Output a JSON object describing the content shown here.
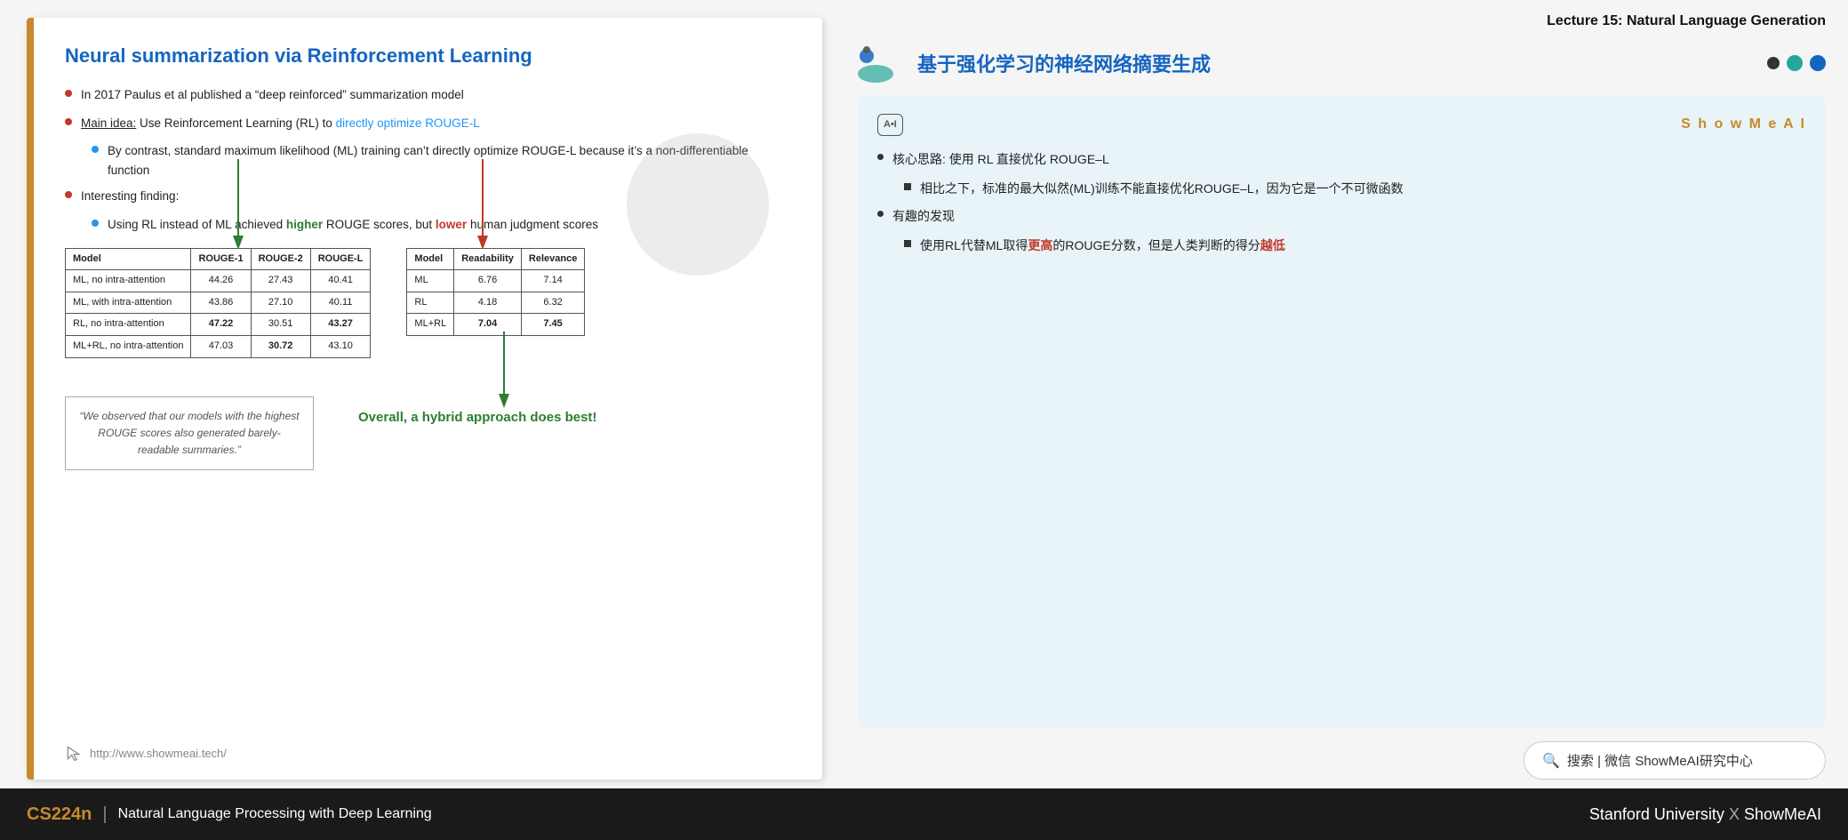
{
  "header": {
    "lecture_title": "Lecture 15: Natural Language Generation"
  },
  "slide": {
    "title": "Neural summarization via Reinforcement Learning",
    "bullets": [
      {
        "id": 1,
        "text_parts": [
          {
            "text": "In 2017 Paulus et al published a “deep reinforced” summarization model",
            "style": "normal"
          }
        ]
      },
      {
        "id": 2,
        "text_parts": [
          {
            "text": "Main idea:",
            "style": "underline"
          },
          {
            "text": " Use Reinforcement Learning (RL) to ",
            "style": "normal"
          },
          {
            "text": "directly optimize ROUGE-L",
            "style": "blue"
          }
        ],
        "subbullets": [
          {
            "text_parts": [
              {
                "text": "By contrast, standard maximum likelihood (ML) training can’t directly optimize ROUGE-L because it’s a non-differentiable function",
                "style": "normal"
              }
            ]
          }
        ]
      },
      {
        "id": 3,
        "text_parts": [
          {
            "text": "Interesting finding:",
            "style": "normal"
          }
        ],
        "subbullets": [
          {
            "text_parts": [
              {
                "text": "Using RL instead of ML achieved ",
                "style": "normal"
              },
              {
                "text": "higher",
                "style": "green"
              },
              {
                "text": " ROUGE scores, but ",
                "style": "normal"
              },
              {
                "text": "lower",
                "style": "red"
              },
              {
                "text": " human judgment scores",
                "style": "normal"
              }
            ]
          }
        ]
      }
    ],
    "table1": {
      "headers": [
        "Model",
        "ROUGE-1",
        "ROUGE-2",
        "ROUGE-L"
      ],
      "rows": [
        [
          "ML, no intra-attention",
          "44.26",
          "27.43",
          "40.41"
        ],
        [
          "ML, with intra-attention",
          "43.86",
          "27.10",
          "40.11"
        ],
        [
          "RL, no intra-attention",
          "47.22",
          "30.51",
          "43.27"
        ],
        [
          "ML+RL, no intra-attention",
          "47.03",
          "30.72",
          "43.10"
        ]
      ],
      "bold_rows": [
        2,
        3
      ],
      "bold_cells": {
        "2": [
          1,
          3
        ],
        "3": [
          2
        ]
      }
    },
    "table2": {
      "headers": [
        "Model",
        "Readability",
        "Relevance"
      ],
      "rows": [
        [
          "ML",
          "6.76",
          "7.14"
        ],
        [
          "RL",
          "4.18",
          "6.32"
        ],
        [
          "ML+RL",
          "7.04",
          "7.45"
        ]
      ],
      "bold_rows": [
        2
      ],
      "bold_cells": {
        "2": [
          1,
          2
        ]
      }
    },
    "quote": "“We observed that our models with the highest ROUGE scores also generated barely-readable summaries.”",
    "overall_text": "Overall, a hybrid approach does best!",
    "footer_url": "http://www.showmeai.tech/"
  },
  "right_panel": {
    "chinese_title": "基于强化学习的神经网络摘要生成",
    "showmeai_brand": "S h o w M e A I",
    "ai_badge": "A•I",
    "content": [
      {
        "type": "main",
        "text": "核心思路: 使用 RL 直接优化 ROUGE–L"
      },
      {
        "type": "sub",
        "text": "相比之下，标准的最大似然(ML)训练不能直接优化ROUGE–L，因为它是一个不可微函数"
      },
      {
        "type": "main",
        "text": "有趣的发现"
      },
      {
        "type": "sub",
        "text_parts": [
          {
            "text": "使用RL代替ML取得",
            "style": "normal"
          },
          {
            "text": "更高",
            "style": "red"
          },
          {
            "text": "的ROUGE分数，但是人类判断的得分",
            "style": "normal"
          },
          {
            "text": "越低",
            "style": "red"
          }
        ]
      }
    ],
    "search_bar": "搜索 | 微信 ShowMeAI研究中心"
  },
  "bottom_bar": {
    "cs_label": "CS224n",
    "divider": "|",
    "course_name": "Natural Language Processing with Deep Learning",
    "right_text": "Stanford University",
    "x_sep": "X",
    "brand": "ShowMeAI"
  },
  "colors": {
    "accent_orange": "#c8892a",
    "accent_blue": "#1565c0",
    "accent_green": "#2e7d32",
    "accent_red": "#c0392b",
    "bottom_bg": "#1a1a1a"
  }
}
